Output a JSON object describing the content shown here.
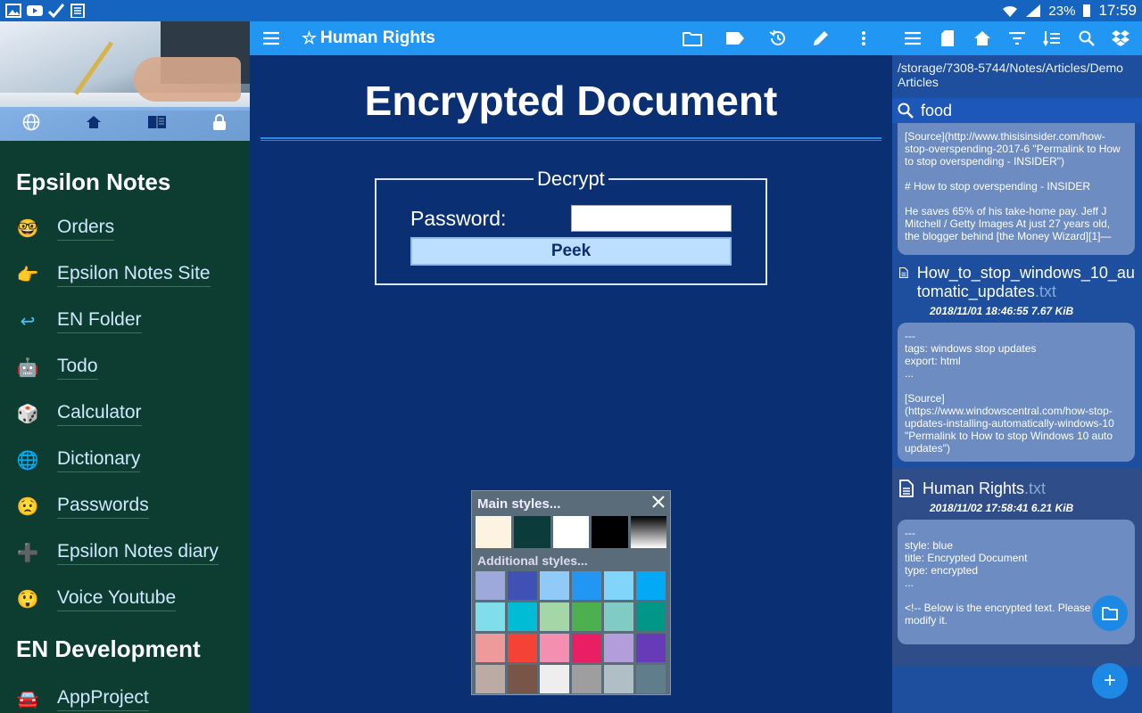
{
  "status_bar": {
    "battery": "23%",
    "time": "17:59"
  },
  "drawer": {
    "sections": [
      {
        "title": "Epsilon Notes",
        "items": [
          {
            "icon": "🤓",
            "label": "Orders"
          },
          {
            "icon": "👉",
            "label": "Epsilon Notes Site"
          },
          {
            "icon": "↩",
            "label": "EN Folder"
          },
          {
            "icon": "🤖",
            "label": "Todo"
          },
          {
            "icon": "🎲",
            "label": "Calculator"
          },
          {
            "icon": "🌐",
            "label": "Dictionary"
          },
          {
            "icon": "😟",
            "label": "Passwords"
          },
          {
            "icon": "➕",
            "label": "Epsilon Notes diary"
          },
          {
            "icon": "😲",
            "label": "Voice Youtube"
          }
        ]
      },
      {
        "title": "EN Development",
        "items": [
          {
            "icon": "🚘",
            "label": "AppProject"
          }
        ]
      }
    ]
  },
  "main": {
    "toolbar_title": "Human Rights",
    "doc_title": "Encrypted Document",
    "decrypt": {
      "legend": "Decrypt",
      "password_label": "Password:",
      "password_value": "",
      "peek_label": "Peek"
    },
    "style_popup": {
      "main_label": "Main styles...",
      "additional_label": "Additional styles...",
      "main_colors": [
        "#fdf3e1",
        "#0c3b3b",
        "#ffffff",
        "#000000",
        "gradient"
      ],
      "additional_colors": [
        "#9fa8da",
        "#3f51b5",
        "#90caf9",
        "#2196f3",
        "#81d4fa",
        "#03a9f4",
        "#80deea",
        "#00bcd4",
        "#a5d6a7",
        "#4caf50",
        "#80cbc4",
        "#009688",
        "#ef9a9a",
        "#f44336",
        "#f48fb1",
        "#e91e63",
        "#b39ddb",
        "#673ab7",
        "#bcaaa4",
        "#795548",
        "#eeeeee",
        "#9e9e9e",
        "#b0bec5",
        "#607d8b"
      ]
    }
  },
  "files": {
    "path": "/storage/7308-5744/Notes/Articles/Demo Articles",
    "search_value": "food",
    "entries": [
      {
        "preview": "[Source](http://www.thisisinsider.com/how-stop-overspending-2017-6 \"Permalink to How to stop overspending - INSIDER\")\n\n# How to stop overspending - INSIDER\n\nHe saves 65% of his take-home pay. Jeff J Mitchell / Getty Images At just 27 years old, the blogger behind [the Money Wizard][1]—"
      },
      {
        "name": "How_to_stop_windows_10_automatic_updates",
        "ext": ".txt",
        "meta": "2018/11/01 18:46:55   7.67 KiB",
        "preview": "---\ntags: windows stop updates\nexport: html\n...\n\n[Source](https://www.windowscentral.com/how-stop-updates-installing-automatically-windows-10 \"Permalink to How to stop Windows 10 auto updates\")"
      },
      {
        "name": "Human Rights",
        "ext": ".txt",
        "meta": "2018/11/02 17:58:41   6.21 KiB",
        "preview": "---\nstyle: blue\ntitle: Encrypted Document\ntype: encrypted\n...\n\n<!-- Below is the encrypted text. Please don't modify it."
      }
    ]
  }
}
